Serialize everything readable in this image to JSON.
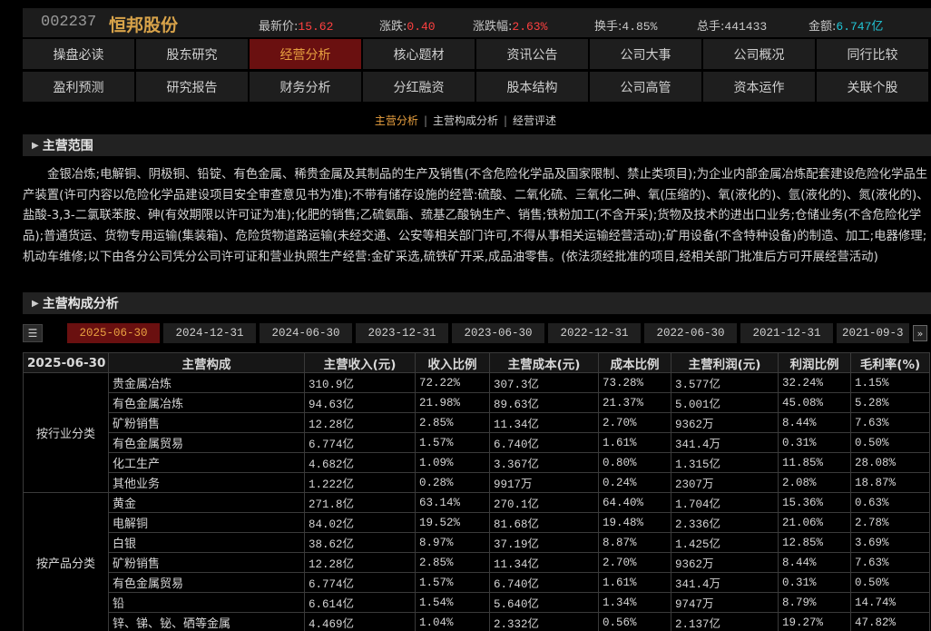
{
  "header": {
    "code": "002237",
    "name": "恒邦股份",
    "latest_label": "最新价:",
    "latest_value": "15.62",
    "change_label": "涨跌:",
    "change_value": "0.40",
    "pct_label": "涨跌幅:",
    "pct_value": "2.63%",
    "turnover_label": "换手:",
    "turnover_value": "4.85%",
    "volume_label": "总手:",
    "volume_value": "441433",
    "amount_label": "金额:",
    "amount_value": "6.747亿"
  },
  "nav": {
    "row1": [
      "操盘必读",
      "股东研究",
      "经营分析",
      "核心题材",
      "资讯公告",
      "公司大事",
      "公司概况",
      "同行比较"
    ],
    "row2": [
      "盈利预测",
      "研究报告",
      "财务分析",
      "分红融资",
      "股本结构",
      "公司高管",
      "资本运作",
      "关联个股"
    ],
    "active": "经营分析"
  },
  "subnav": {
    "items": [
      "主营分析",
      "主营构成分析",
      "经营评述"
    ],
    "separator": "|"
  },
  "scope": {
    "title": "主营范围",
    "text": "金银冶炼;电解铜、阴极铜、铅锭、有色金属、稀贵金属及其制品的生产及销售(不含危险化学品及国家限制、禁止类项目);为企业内部金属冶炼配套建设危险化学品生产装置(许可内容以危险化学品建设项目安全审查意见书为准);不带有储存设施的经营:硫酸、二氧化硫、三氧化二砷、氧(压缩的)、氧(液化的)、氩(液化的)、氮(液化的)、盐酸-3,3-二氯联苯胺、砷(有效期限以许可证为准);化肥的销售;乙硫氨酯、巯基乙酸钠生产、销售;铁粉加工(不含开采);货物及技术的进出口业务;仓储业务(不含危险化学品);普通货运、货物专用运输(集装箱)、危险货物道路运输(未经交通、公安等相关部门许可,不得从事相关运输经营活动);矿用设备(不含特种设备)的制造、加工;电器修理;机动车维修;以下由各分公司凭分公司许可证和营业执照生产经营:金矿采选,硫铁矿开采,成品油零售。(依法须经批准的项目,经相关部门批准后方可开展经营活动)"
  },
  "composition": {
    "title": "主营构成分析",
    "list_icon": "list-icon",
    "more_icon": "double-chevron-right-icon",
    "dates": [
      "2025-06-30",
      "2024-12-31",
      "2024-06-30",
      "2023-12-31",
      "2023-06-30",
      "2022-12-31",
      "2022-06-30",
      "2021-12-31",
      "2021-09-3"
    ],
    "active_date": "2025-06-30"
  },
  "table": {
    "columns": [
      "2025-06-30",
      "主营构成",
      "主营收入(元)",
      "收入比例",
      "主营成本(元)",
      "成本比例",
      "主营利润(元)",
      "利润比例",
      "毛利率(%)"
    ],
    "groups": [
      {
        "label": "按行业分类",
        "rows": [
          [
            "贵金属冶炼",
            "310.9亿",
            "72.22%",
            "307.3亿",
            "73.28%",
            "3.577亿",
            "32.24%",
            "1.15%"
          ],
          [
            "有色金属冶炼",
            "94.63亿",
            "21.98%",
            "89.63亿",
            "21.37%",
            "5.001亿",
            "45.08%",
            "5.28%"
          ],
          [
            "矿粉销售",
            "12.28亿",
            "2.85%",
            "11.34亿",
            "2.70%",
            "9362万",
            "8.44%",
            "7.63%"
          ],
          [
            "有色金属贸易",
            "6.774亿",
            "1.57%",
            "6.740亿",
            "1.61%",
            "341.4万",
            "0.31%",
            "0.50%"
          ],
          [
            "化工生产",
            "4.682亿",
            "1.09%",
            "3.367亿",
            "0.80%",
            "1.315亿",
            "11.85%",
            "28.08%"
          ],
          [
            "其他业务",
            "1.222亿",
            "0.28%",
            "9917万",
            "0.24%",
            "2307万",
            "2.08%",
            "18.87%"
          ]
        ]
      },
      {
        "label": "按产品分类",
        "rows": [
          [
            "黄金",
            "271.8亿",
            "63.14%",
            "270.1亿",
            "64.40%",
            "1.704亿",
            "15.36%",
            "0.63%"
          ],
          [
            "电解铜",
            "84.02亿",
            "19.52%",
            "81.68亿",
            "19.48%",
            "2.336亿",
            "21.06%",
            "2.78%"
          ],
          [
            "白银",
            "38.62亿",
            "8.97%",
            "37.19亿",
            "8.87%",
            "1.425亿",
            "12.85%",
            "3.69%"
          ],
          [
            "矿粉销售",
            "12.28亿",
            "2.85%",
            "11.34亿",
            "2.70%",
            "9362万",
            "8.44%",
            "7.63%"
          ],
          [
            "有色金属贸易",
            "6.774亿",
            "1.57%",
            "6.740亿",
            "1.61%",
            "341.4万",
            "0.31%",
            "0.50%"
          ],
          [
            "铅",
            "6.614亿",
            "1.54%",
            "5.640亿",
            "1.34%",
            "9747万",
            "8.79%",
            "14.74%"
          ],
          [
            "锌、锑、铋、硒等金属",
            "4.469亿",
            "1.04%",
            "2.332亿",
            "0.56%",
            "2.137亿",
            "19.27%",
            "47.82%"
          ]
        ]
      }
    ]
  }
}
